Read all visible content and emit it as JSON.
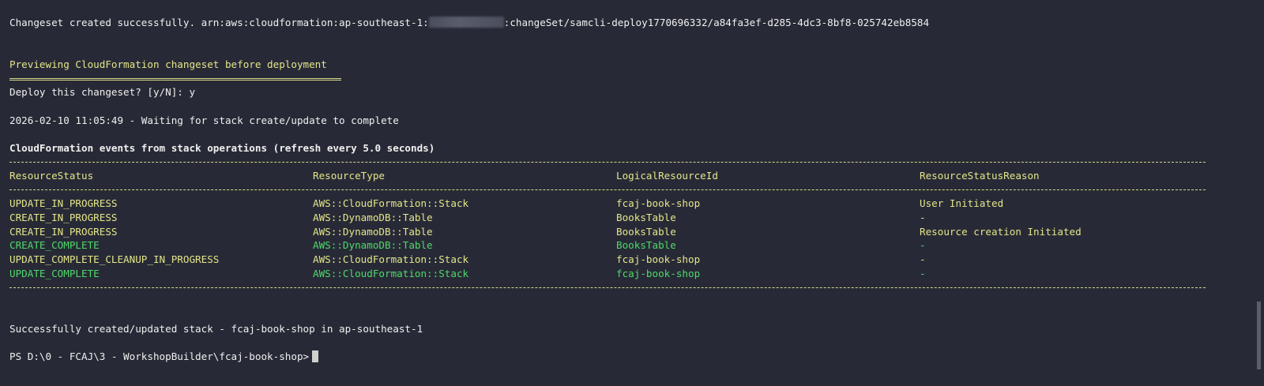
{
  "changeset_line": {
    "prefix": "Changeset created successfully. arn:aws:cloudformation:ap-southeast-1:",
    "suffix": ":changeSet/samcli-deploy1770696332/a84fa3ef-d285-4dc3-8bf8-025742eb8584"
  },
  "preview_title": "Previewing CloudFormation changeset before deployment",
  "prompt_line": "Deploy this changeset? [y/N]: y",
  "waiting_line": "2026-02-10 11:05:49 - Waiting for stack create/update to complete",
  "events_title": "CloudFormation events from stack operations (refresh every 5.0 seconds)",
  "table": {
    "headers": [
      "ResourceStatus",
      "ResourceType",
      "LogicalResourceId",
      "ResourceStatusReason"
    ],
    "rows": [
      {
        "cells": [
          "UPDATE_IN_PROGRESS",
          "AWS::CloudFormation::Stack",
          "fcaj-book-shop",
          "User Initiated"
        ],
        "status": "progress"
      },
      {
        "cells": [
          "CREATE_IN_PROGRESS",
          "AWS::DynamoDB::Table",
          "BooksTable",
          "-"
        ],
        "status": "progress"
      },
      {
        "cells": [
          "CREATE_IN_PROGRESS",
          "AWS::DynamoDB::Table",
          "BooksTable",
          "Resource creation Initiated"
        ],
        "status": "progress"
      },
      {
        "cells": [
          "CREATE_COMPLETE",
          "AWS::DynamoDB::Table",
          "BooksTable",
          "-"
        ],
        "status": "complete"
      },
      {
        "cells": [
          "UPDATE_COMPLETE_CLEANUP_IN_PROGRESS",
          "AWS::CloudFormation::Stack",
          "fcaj-book-shop",
          "-"
        ],
        "status": "progress"
      },
      {
        "cells": [
          "UPDATE_COMPLETE",
          "AWS::CloudFormation::Stack",
          "fcaj-book-shop",
          "-"
        ],
        "status": "complete"
      }
    ]
  },
  "success_line": "Successfully created/updated stack - fcaj-book-shop in ap-southeast-1",
  "shell_prompt": "PS D:\\0 - FCAJ\\3 - WorkshopBuilder\\fcaj-book-shop>",
  "colors": {
    "background": "#272a36",
    "progress": "#e5e58a",
    "complete": "#4fd86a",
    "text": "#f0f0f0"
  }
}
